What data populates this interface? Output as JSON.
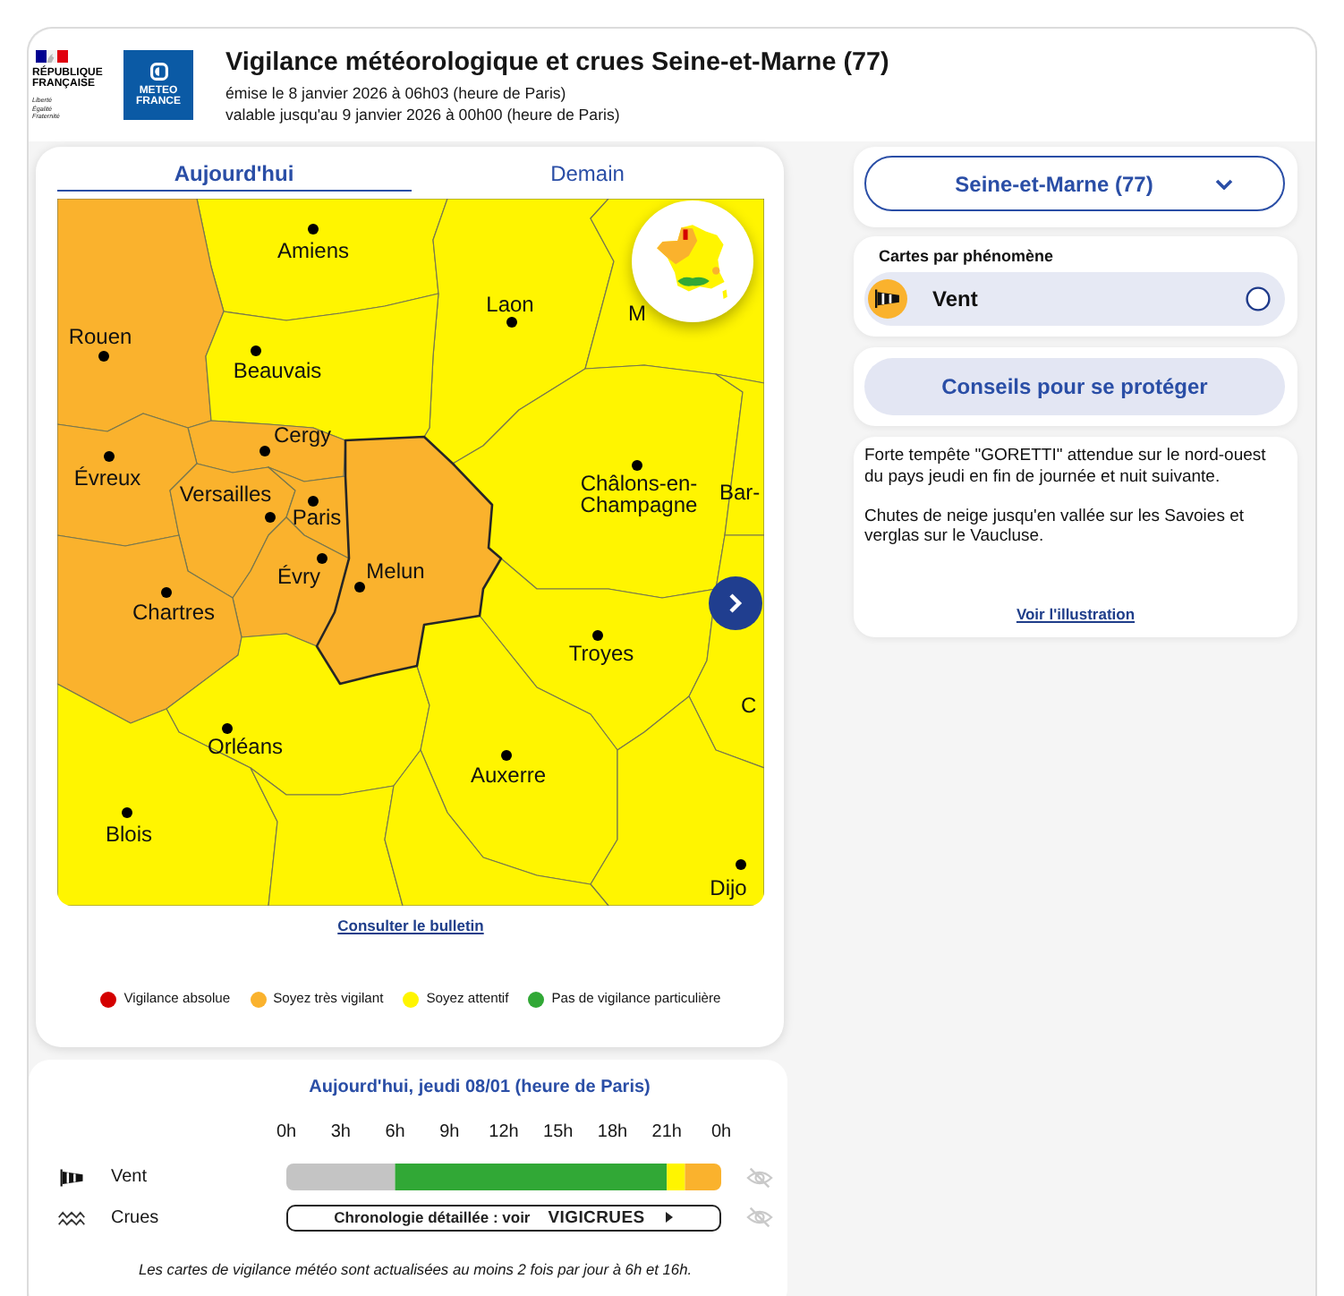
{
  "header": {
    "republic_logo": {
      "name": "RÉPUBLIQUE FRANÇAISE",
      "motto": "Liberté Égalité Fraternité"
    },
    "agency_logo": "METEO FRANCE",
    "title": "Vigilance météorologique et crues Seine-et-Marne (77)",
    "issued": "émise le 8 janvier 2026 à 06h03 (heure de Paris)",
    "valid_until": "valable jusqu'au 9 janvier 2026 à 00h00 (heure de Paris)"
  },
  "map_panel": {
    "tabs": [
      {
        "label": "Aujourd'hui",
        "selected": true
      },
      {
        "label": "Demain",
        "selected": false
      }
    ],
    "map": {
      "departments": [
        {
          "city": "Amiens",
          "color": "#fff500",
          "selected": false
        },
        {
          "city": "Laon",
          "color": "#fff500",
          "selected": false
        },
        {
          "city": "M",
          "color": "#fff500",
          "selected": false
        },
        {
          "city": "Rouen",
          "color": "#fab22d",
          "selected": false
        },
        {
          "city": "Beauvais",
          "color": "#fff500",
          "selected": false
        },
        {
          "city": "Cergy",
          "color": "#fab22d",
          "selected": false
        },
        {
          "city": "Évreux",
          "color": "#fab22d",
          "selected": false
        },
        {
          "city": "Versailles",
          "color": "#fab22d",
          "selected": false
        },
        {
          "city": "Paris",
          "color": "#fab22d",
          "selected": false
        },
        {
          "city": "Châlons-en-Champagne",
          "color": "#fff500",
          "selected": false
        },
        {
          "city": "Bar-",
          "color": "#fff500",
          "selected": false
        },
        {
          "city": "Évry",
          "color": "#fab22d",
          "selected": false
        },
        {
          "city": "Melun",
          "color": "#fab22d",
          "selected": true
        },
        {
          "city": "Chartres",
          "color": "#fab22d",
          "selected": false
        },
        {
          "city": "Troyes",
          "color": "#fff500",
          "selected": false
        },
        {
          "city": "C",
          "color": "#fff500",
          "selected": false
        },
        {
          "city": "Orléans",
          "color": "#fff500",
          "selected": false
        },
        {
          "city": "Auxerre",
          "color": "#fff500",
          "selected": false
        },
        {
          "city": "Blois",
          "color": "#fff500",
          "selected": false
        },
        {
          "city": "Dijo",
          "color": "#fff500",
          "selected": false
        },
        {
          "color": "#fff500",
          "selected": false
        },
        {
          "color": "#fff500",
          "selected": false
        }
      ]
    },
    "bulletin_link": "Consulter le bulletin",
    "legend": [
      {
        "label": "Vigilance absolue",
        "color": "#d40000"
      },
      {
        "label": "Soyez très vigilant",
        "color": "#fab22d"
      },
      {
        "label": "Soyez attentif",
        "color": "#fff500"
      },
      {
        "label": "Pas de vigilance particulière",
        "color": "#31a836"
      }
    ]
  },
  "sidebar": {
    "department_select": "Seine-et-Marne (77)",
    "phenomena": {
      "title": "Cartes par phénomène",
      "items": [
        {
          "label": "Vent",
          "color": "#fab22d",
          "selected": false
        }
      ]
    },
    "advice_button": "Conseils pour se protéger",
    "bulletin": {
      "paragraphs": [
        "Forte tempête \"GORETTI\" attendue sur le nord-ouest du pays jeudi en fin de journée et nuit suivante.",
        "Chutes de neige jusqu'en vallée sur les Savoies et verglas sur le Vaucluse."
      ],
      "link": "Voir l'illustration"
    }
  },
  "timeline": {
    "title": "Aujourd'hui, jeudi 08/01 (heure de Paris)",
    "rows": [
      {
        "kind": "chart",
        "label": "Vent",
        "axis_end_label": "0h",
        "chart_data": {
          "type": "bar",
          "orientation": "horizontal",
          "stacked": true,
          "series": [
            {
              "color": "#c4c4c4",
              "values": [
                6
              ]
            },
            {
              "color": "#31a836",
              "values": [
                15
              ]
            },
            {
              "color": "#fff500",
              "values": [
                1
              ]
            },
            {
              "color": "#fab22d",
              "values": [
                2
              ]
            }
          ],
          "xlim": [
            0,
            24
          ],
          "xticks": [
            {
              "value": 0,
              "label": "0h"
            },
            {
              "value": 3,
              "label": "3h"
            },
            {
              "value": 6,
              "label": "6h"
            },
            {
              "value": 9,
              "label": "9h"
            },
            {
              "value": 12,
              "label": "12h"
            },
            {
              "value": 15,
              "label": "15h"
            },
            {
              "value": 18,
              "label": "18h"
            },
            {
              "value": 21,
              "label": "21h"
            }
          ]
        }
      },
      {
        "kind": "link",
        "label": "Crues",
        "text": "Chronologie détaillée : voir",
        "brand": "VIGICRUES"
      }
    ]
  },
  "footnote": "Les cartes de vigilance météo sont actualisées au moins 2 fois par jour à 6h et 16h."
}
